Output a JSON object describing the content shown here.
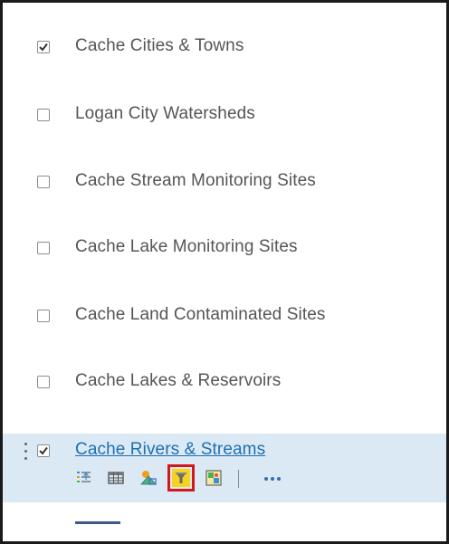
{
  "layers": [
    {
      "label": "Cache Cities & Towns",
      "checked": true
    },
    {
      "label": "Logan City Watersheds",
      "checked": false
    },
    {
      "label": "Cache Stream Monitoring Sites",
      "checked": false
    },
    {
      "label": "Cache Lake Monitoring Sites",
      "checked": false
    },
    {
      "label": "Cache Land Contaminated Sites",
      "checked": false
    },
    {
      "label": "Cache Lakes & Reservoirs",
      "checked": false
    }
  ],
  "selected_layer": {
    "label": "Cache Rivers & Streams",
    "checked": true
  },
  "toolbar": {
    "more_label": "···",
    "tools": [
      "legend-icon",
      "table-icon",
      "change-style-icon",
      "filter-icon",
      "perform-analysis-icon",
      "more-options-icon"
    ],
    "highlighted_tool": "filter-icon",
    "highlight_color": "#d0191c"
  },
  "colors": {
    "selected_background": "#dbe9f4",
    "link": "#1f6fb2",
    "label": "#555555"
  }
}
